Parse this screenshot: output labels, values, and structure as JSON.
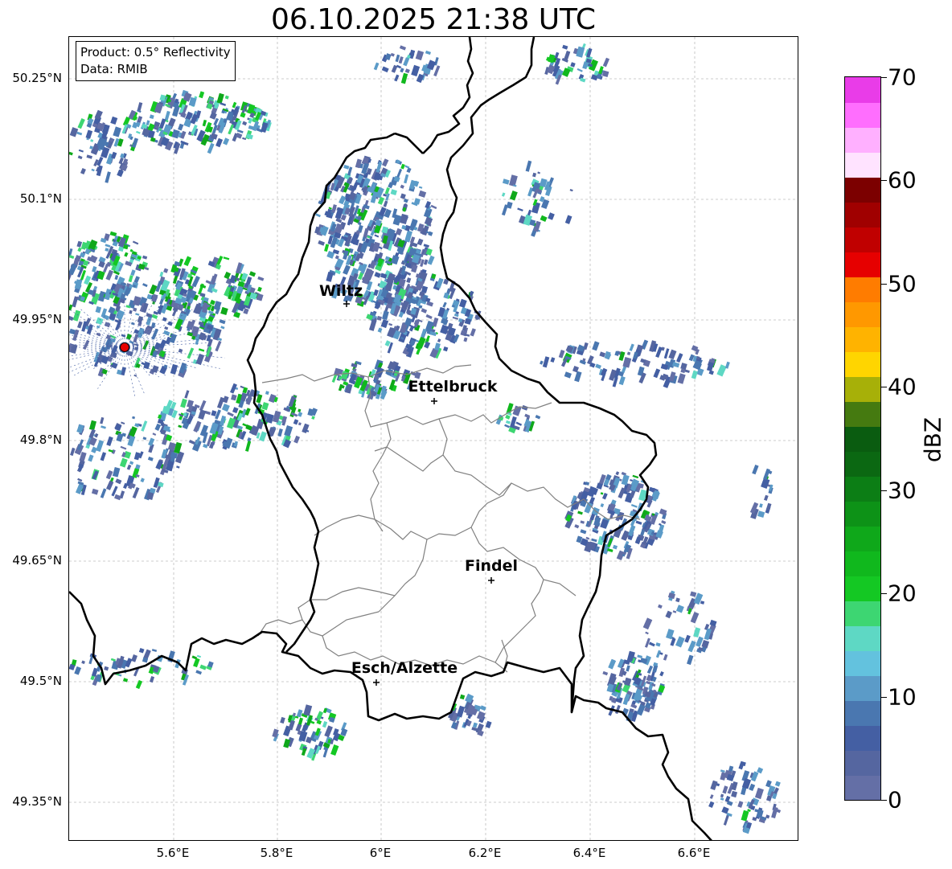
{
  "title": "06.10.2025 21:38 UTC",
  "info": {
    "product": "Product: 0.5° Reflectivity",
    "data": "Data: RMIB"
  },
  "axes": {
    "lat_ticks": [
      "50.25°N",
      "50.1°N",
      "49.95°N",
      "49.8°N",
      "49.65°N",
      "49.5°N",
      "49.35°N"
    ],
    "lon_ticks": [
      "5.6°E",
      "5.8°E",
      "6°E",
      "6.2°E",
      "6.4°E",
      "6.6°E"
    ]
  },
  "cities": [
    {
      "name": "Wiltz"
    },
    {
      "name": "Ettelbruck"
    },
    {
      "name": "Findel"
    },
    {
      "name": "Esch/Alzette"
    }
  ],
  "colorbar": {
    "label": "dBZ",
    "ticks": [
      "0",
      "10",
      "20",
      "30",
      "40",
      "50",
      "60",
      "70"
    ],
    "colors": [
      "#646fa6",
      "#5566a0",
      "#445fa3",
      "#4a77b0",
      "#5b9bc8",
      "#63c2de",
      "#5ed8c4",
      "#3dd672",
      "#14c823",
      "#10b81d",
      "#0fa81a",
      "#0d9217",
      "#0c7e15",
      "#0b6812",
      "#0a5c10",
      "#457a10",
      "#a7b008",
      "#ffd500",
      "#ffb300",
      "#ff9800",
      "#ff7c00",
      "#e60000",
      "#c00000",
      "#a00000",
      "#7c0000",
      "#ffe3ff",
      "#ffb0ff",
      "#ff6efe",
      "#e93ce8"
    ]
  },
  "radar_site": {
    "color": "#e60000"
  }
}
